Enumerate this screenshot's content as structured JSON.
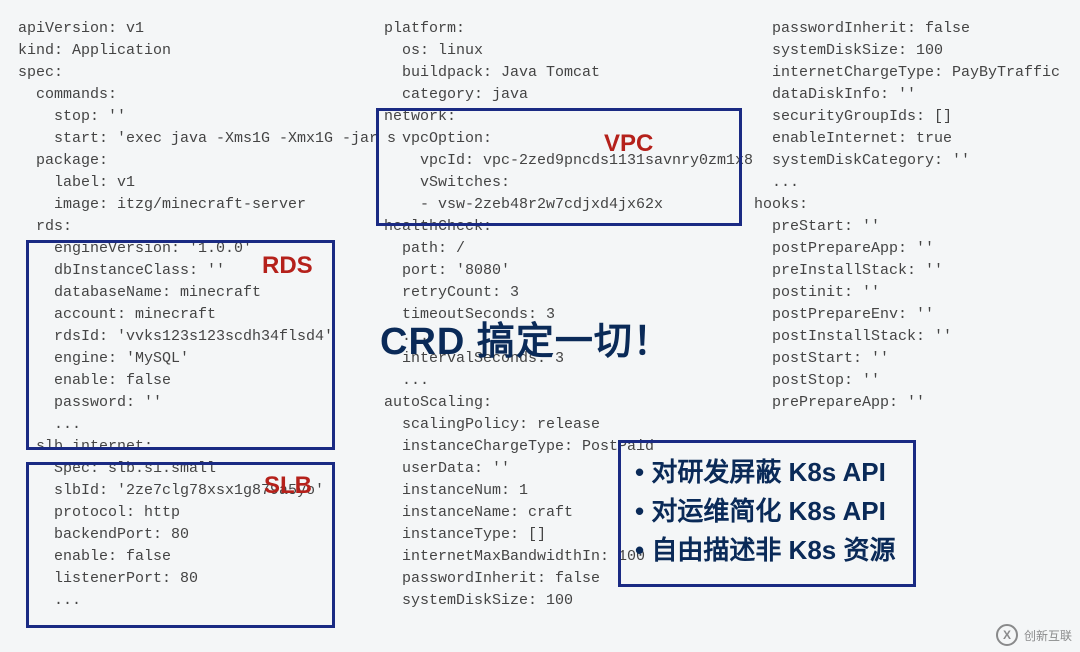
{
  "col1": [
    "",
    "apiVersion: v1",
    "kind: Application",
    "spec:",
    "  commands:",
    "    stop: ''",
    "    start: 'exec java -Xms1G -Xmx1G -jar s",
    "  package:",
    "    label: v1",
    "    image: itzg/minecraft-server",
    "  rds:",
    "    engineVersion: '1.0.0'",
    "    dbInstanceClass: ''",
    "    databaseName: minecraft",
    "    account: minecraft",
    "    rdsId: 'vvks123s123scdh34flsd4'",
    "    engine: 'MySQL'",
    "    enable: false",
    "    password: ''",
    "    ...",
    "  slb.internet:",
    "    Spec: slb.s1.small",
    "    slbId: '2ze7clg78xsx1g879a5yo'",
    "    protocol: http",
    "    backendPort: 80",
    "    enable: false",
    "    listenerPort: 80",
    "    ..."
  ],
  "col2": [
    "platform:",
    "  os: linux",
    "  buildpack: Java Tomcat",
    "  category: java",
    "network:",
    "  vpcOption:",
    "    vpcId: vpc-2zed9pncds1131savnry0zm1x8",
    "    vSwitches:",
    "    - vsw-2zeb48r2w7cdjxd4jx62x",
    "healthCheck:",
    "  path: /",
    "  port: '8080'",
    "  retryCount: 3",
    "  timeoutSeconds: 3",
    "  ...",
    "  intervalSeconds: 3",
    "  ...",
    "autoScaling:",
    "  scalingPolicy: release",
    "  instanceChargeType: PostPaid",
    "  userData: ''",
    "  instanceNum: 1",
    "  instanceName: craft",
    "  instanceType: []",
    "  internetMaxBandwidthIn: 100",
    "  passwordInherit: false",
    "  systemDiskSize: 100"
  ],
  "col3": [
    "  passwordInherit: false",
    "  systemDiskSize: 100",
    "  internetChargeType: PayByTraffic",
    "  dataDiskInfo: ''",
    "  securityGroupIds: []",
    "  enableInternet: true",
    "  systemDiskCategory: ''",
    "  ...",
    "hooks:",
    "  preStart: ''",
    "  postPrepareApp: ''",
    "  preInstallStack: ''",
    "  postinit: ''",
    "  postPrepareEnv: ''",
    "  postInstallStack: ''",
    "  postStart: ''",
    "  postStop: ''",
    "  prePrepareApp: ''"
  ],
  "labels": {
    "rds": "RDS",
    "slb": "SLB",
    "vpc": "VPC",
    "headline": "CRD 搞定一切！"
  },
  "bullets": [
    "对研发屏蔽 K8s API",
    "对运维简化 K8s API",
    "自由描述非 K8s 资源"
  ],
  "watermark": {
    "logo": "X",
    "text": "创新互联"
  }
}
